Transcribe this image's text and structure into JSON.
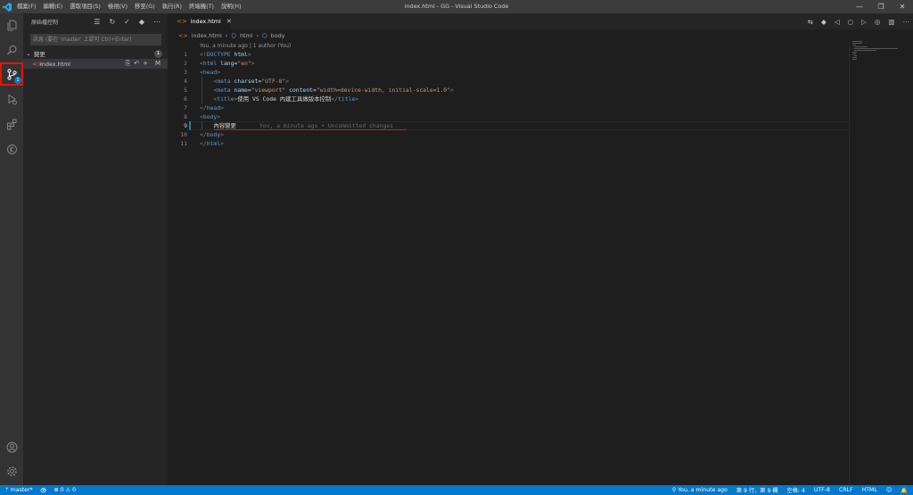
{
  "window": {
    "title": "index.html - GG - Visual Studio Code",
    "menu": [
      "檔案(F)",
      "編輯(E)",
      "選取項目(S)",
      "檢視(V)",
      "移至(G)",
      "執行(R)",
      "終端機(T)",
      "說明(H)"
    ],
    "controls": [
      "minimize",
      "restore",
      "close"
    ]
  },
  "activity_bar": {
    "items": [
      "explorer",
      "search",
      "source-control",
      "run-debug",
      "extensions",
      "timeline"
    ],
    "active": "source-control",
    "source_control_badge": "1",
    "bottom": [
      "account",
      "manage"
    ]
  },
  "sidebar": {
    "title": "原始檔控制",
    "commit_placeholder": "訊息 (要在 'master' 上認可 Ctrl+Enter)",
    "changes_label": "變更",
    "changes_count": "1",
    "file": {
      "name": "index.html",
      "status": "M"
    }
  },
  "editor": {
    "tab_label": "index.html",
    "breadcrumb": [
      "index.html",
      "html",
      "body"
    ],
    "blame_header": "You, a minute ago | 1 author (You)",
    "lines": [
      {
        "n": "1",
        "text": "<!DOCTYPE html>"
      },
      {
        "n": "2",
        "text": "<html lang=\"en\">"
      },
      {
        "n": "3",
        "text": "<head>"
      },
      {
        "n": "4",
        "text": "    <meta charset=\"UTF-8\">"
      },
      {
        "n": "5",
        "text": "    <meta name=\"viewport\" content=\"width=device-width, initial-scale=1.0\">"
      },
      {
        "n": "6",
        "text": "    <title>使用 VS Code 內建工具做版本控制</title>"
      },
      {
        "n": "7",
        "text": "</head>"
      },
      {
        "n": "8",
        "text": "<body>"
      },
      {
        "n": "9",
        "text": "    內容變更"
      },
      {
        "n": "10",
        "text": "</body>"
      },
      {
        "n": "11",
        "text": "</html>"
      }
    ],
    "inline_blame": "You, a minute ago • Uncommitted changes"
  },
  "status_bar": {
    "branch": "master*",
    "errors": "0",
    "warnings": "0",
    "blame": "You, a minute ago",
    "cursor": "第 9 行，第 9 欄",
    "indent": "空格: 4",
    "encoding": "UTF-8",
    "eol": "CRLF",
    "language": "HTML"
  },
  "colors": {
    "accent": "#007acc",
    "highlight": "#e51400"
  }
}
